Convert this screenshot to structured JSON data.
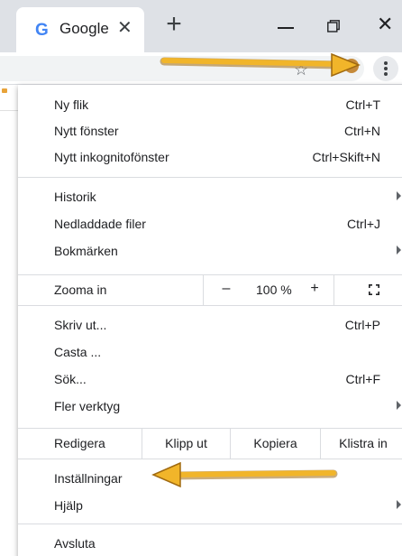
{
  "tab": {
    "title": "Google",
    "close": "✕",
    "favicon_letter": "G"
  },
  "new_tab": "+",
  "window_controls": {
    "close": "✕"
  },
  "toolbar": {
    "star_icon": "☆",
    "menu_icon": "three-dots-vertical"
  },
  "menu": {
    "group1": [
      {
        "label": "Ny flik",
        "shortcut": "Ctrl+T"
      },
      {
        "label": "Nytt fönster",
        "shortcut": "Ctrl+N"
      },
      {
        "label": "Nytt inkognitofönster",
        "shortcut": "Ctrl+Skift+N"
      }
    ],
    "group2": [
      {
        "label": "Historik",
        "shortcut": ""
      },
      {
        "label": "Nedladdade filer",
        "shortcut": "Ctrl+J"
      },
      {
        "label": "Bokmärken",
        "shortcut": ""
      }
    ],
    "zoom": {
      "label": "Zooma in",
      "minus": "–",
      "value": "100 %",
      "plus": "+"
    },
    "group3": [
      {
        "label": "Skriv ut...",
        "shortcut": "Ctrl+P"
      },
      {
        "label": "Casta ...",
        "shortcut": ""
      },
      {
        "label": "Sök...",
        "shortcut": "Ctrl+F"
      },
      {
        "label": "Fler verktyg",
        "shortcut": ""
      }
    ],
    "edit": {
      "label": "Redigera",
      "cut": "Klipp ut",
      "copy": "Kopiera",
      "paste": "Klistra in"
    },
    "group4": [
      {
        "label": "Inställningar",
        "shortcut": ""
      },
      {
        "label": "Hjälp",
        "shortcut": ""
      }
    ],
    "exit": {
      "label": "Avsluta"
    }
  },
  "colors": {
    "annotation_arrow": "#e8a91c",
    "titlebar": "#dee1e6"
  }
}
